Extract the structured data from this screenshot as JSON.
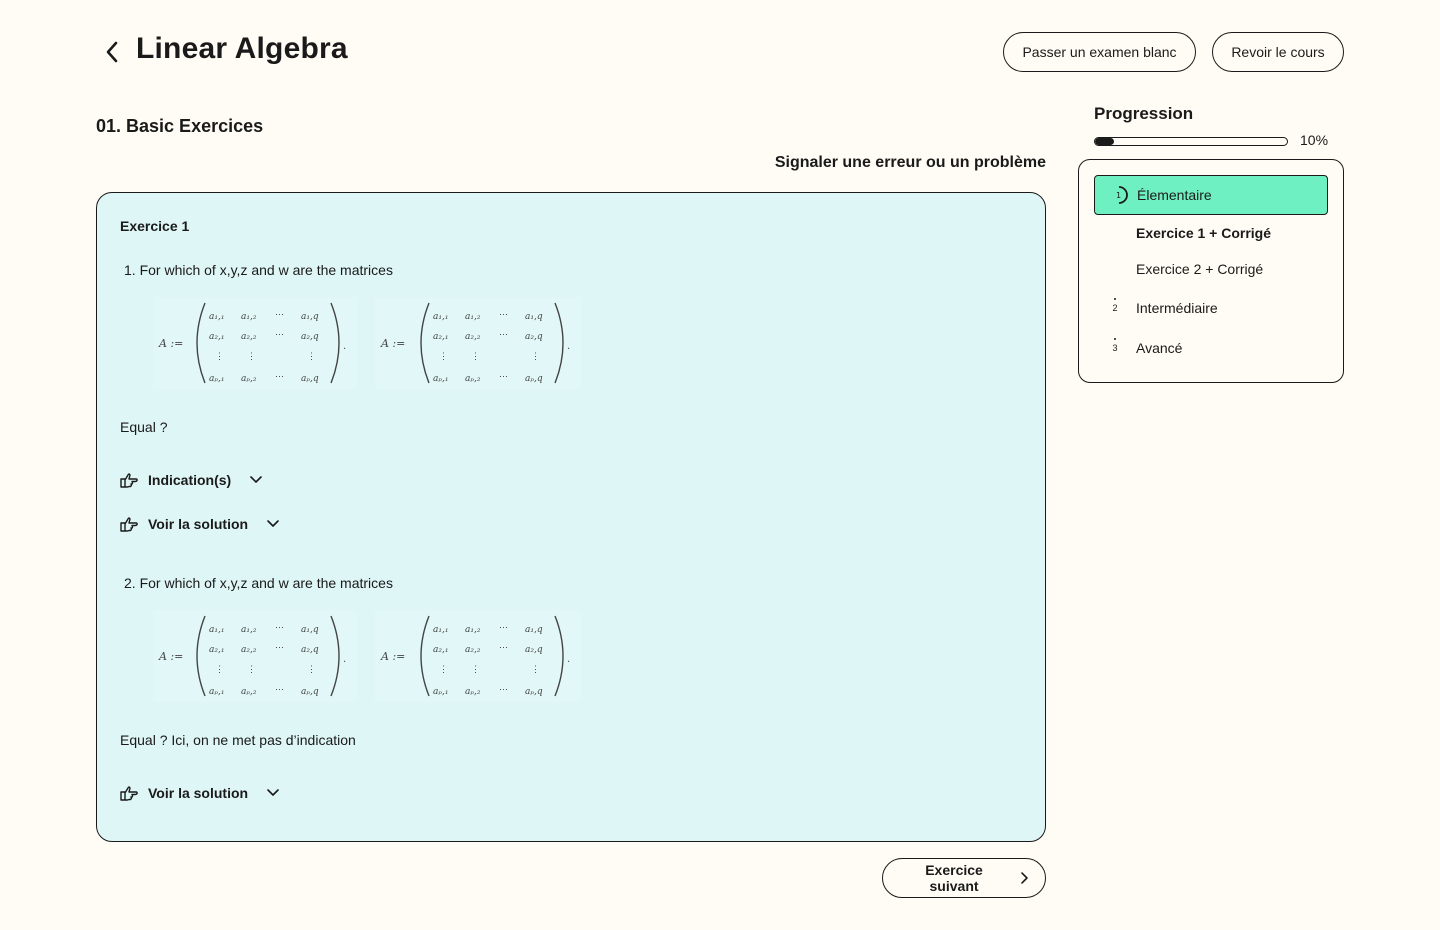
{
  "header": {
    "title": "Linear Algebra",
    "exam_button": "Passer un examen blanc",
    "review_button": "Revoir le cours"
  },
  "section": {
    "title": "01. Basic Exercices",
    "report_link": "Signaler une erreur ou un problème"
  },
  "exercise": {
    "title": "Exercice 1",
    "questions": [
      {
        "text": "1. For which of x,y,z and w are the matrices",
        "matrix_label": "A :=",
        "after": "Equal ?",
        "toggles": [
          "Indication(s)",
          "Voir la solution"
        ]
      },
      {
        "text": "2. For which of x,y,z and w are the matrices",
        "matrix_label": "A :=",
        "after": "Equal ? Ici, on ne met pas d’indication",
        "toggles": [
          "Voir la solution"
        ]
      }
    ],
    "matrix_entries": {
      "row1": [
        "a₁,₁",
        "a₁,₂",
        "⋯",
        "a₁,q"
      ],
      "row2": [
        "a₂,₁",
        "a₂,₂",
        "⋯",
        "a₂,q"
      ],
      "row3": [
        "⋮",
        "⋮",
        "",
        "⋮"
      ],
      "row4": [
        "aₚ,₁",
        "aₚ,₂",
        "⋯",
        "aₚ,q"
      ]
    },
    "next_button": "Exercice suivant"
  },
  "progress": {
    "label": "Progression",
    "percent": 10,
    "percent_text": "10%",
    "levels": [
      {
        "num": "1",
        "name": "Élementaire",
        "active": true
      },
      {
        "num": "2",
        "name": "Intermédiaire",
        "active": false
      },
      {
        "num": "3",
        "name": "Avancé",
        "active": false
      }
    ],
    "subitems": [
      "Exercice 1  + Corrigé",
      "Exercice 2 + Corrigé"
    ]
  },
  "colors": {
    "background": "#fefcf4",
    "card": "#dff6f6",
    "accent": "#6ff0c2",
    "ink": "#1a1a1a"
  },
  "icons": [
    "chevron-left-icon",
    "pointing-hand-icon",
    "chevron-down-icon",
    "chevron-right-icon",
    "progress-ring-icon"
  ]
}
